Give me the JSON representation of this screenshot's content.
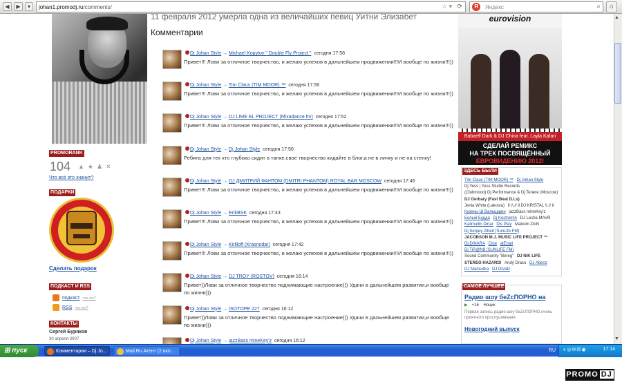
{
  "browser": {
    "url_domain": "johan1.promodj.ru",
    "url_path": "/comments/",
    "search_placeholder": "Яндекс",
    "search_logo": "Я"
  },
  "article_title": "11 февраля 2012 умерла одна из величайших певиц Уитни Элизабет",
  "comments_heading": "Комментарии",
  "sidebar": {
    "promorank_title": "PROMORANK",
    "rank_value": "104",
    "rank_link": "Что всё это значит?",
    "gifts_title": "ПОДАРКИ",
    "gift_link": "Сделать подарок",
    "podcast_title": "ПОДКАСТ И RSS",
    "podcast_label": "подкаст",
    "rss_label": "RSS",
    "small_label": "что это?",
    "contacts_title": "КОНТАКТЫ",
    "contact_name": "Сергей Буряков",
    "contact_date": "30 апреля 2007"
  },
  "comments": [
    {
      "author": "Dj Johan Style",
      "target": "Michael Kopytov \" Double Fly Project \"",
      "time": "сегодня 17:58",
      "text": "Привет!!! Лови за отличное творчество, и желаю успехов в дальнейшем продвижении!!!И вообще по жизни!!!))"
    },
    {
      "author": "Dj Johan Style",
      "target": "Tim Claus (TIM MOOR) ™",
      "time": "сегодня 17:56",
      "text": "Привет!!! Лови за отличное творчество, и желаю успехов в дальнейшем продвижении!!!И вообще по жизни!!!))"
    },
    {
      "author": "Dj Johan Style",
      "target": "DJ LIME EL PROJECT (Mixadance.fm)",
      "time": "сегодня 17:52",
      "text": "Привет!!! Лови за отличное творчество, и желаю успехов в дальнейшем продвижении!!!И вообще по жизни!!!))"
    },
    {
      "author": "Dj Johan Style",
      "target": "Dj Johan Style",
      "time": "сегодня 17:50",
      "text": "Ребята для тех кто глубоко сидит в танке,свое творчество кидайте в блог,а не в личку и не на стенку!"
    },
    {
      "author": "Dj Johan Style",
      "target": "DJ ДМИТРИЙ ФАНТОМ (DMITRI PHANTOM) ROYAL BAR MOSCOW",
      "time": "сегодня 17:46",
      "text": "Привет!!! Лови за отличное творчество, и желаю успехов в дальнейшем продвижении!!!И вообще по жизни!!!))"
    },
    {
      "author": "Dj Johan Style",
      "target": "ErikBSK",
      "time": "сегодня 17:43",
      "text": "Привет!!! Лови за отличное творчество, и желаю успехов в дальнейшем продвижении!!!И вообще по жизни!!!))"
    },
    {
      "author": "Dj Johan Style",
      "target": "Kirilloff (Krasnodar)",
      "time": "сегодня 17:42",
      "text": "Привет!!! Лови за отличное творчество, и желаю успехов в дальнейшем продвижении!!!И вообще по жизни!!!))"
    },
    {
      "author": "Dj Johan Style",
      "target": "DJ TROY (ROSTOV)",
      "time": "сегодня 16:14",
      "text": "Привет))Лови за отличное творчество поднимающие настроение))) Удачи в дальнейшем развитии,и вообще по жизни)))"
    },
    {
      "author": "Dj Johan Style",
      "target": "ISOTOPE 227",
      "time": "сегодня 16:12",
      "text": "Привет))Лови за отличное творчество поднимающие настроение))) Удачи в дальнейшем развитии,и вообще по жизни)))"
    },
    {
      "author": "Dj Johan Style",
      "target": "jazzBass mineKey'z",
      "time": "сегодня 16:12",
      "text": ""
    }
  ],
  "promo": {
    "logo": "eurovision",
    "caption": "Babaeff Dark & DJ China feat. Layla Kafari",
    "cta_line1": "СДЕЛАЙ РЕМИКС",
    "cta_line2": "НА ТРЕК ПОСВЯЩЁННЫЙ",
    "cta_line3": "ЕВРОВИДЕНИЮ 2012!"
  },
  "visitors": {
    "title": "ЗДЕСЬ БЫЛИ",
    "items": [
      {
        "name": "Tim Claus (TIM MOOR) ™",
        "style": "link"
      },
      {
        "name": "Dj Johan Style",
        "style": "link"
      },
      {
        "name": "Dj Yess | Yess Studio Records",
        "style": ""
      },
      {
        "name": "(Clubmood) Dj Performance & Dj Tenere (Moscow)",
        "style": ""
      },
      {
        "name": "DJ Gerbary (Fast Beat D.Ls)",
        "style": "bold"
      },
      {
        "name": "Jenia White (Lakosta)",
        "style": ""
      },
      {
        "name": "Il \\\\.// il DJ KRISTAL \\\\.// il",
        "style": ""
      },
      {
        "name": "Кузены Ш Вальцарин",
        "style": "link"
      },
      {
        "name": "jazzBass mineKey'z",
        "style": ""
      },
      {
        "name": "Белый Будда",
        "style": "link"
      },
      {
        "name": "Dj Kostromin",
        "style": "link"
      },
      {
        "name": "DJ Lesha MAVR",
        "style": ""
      },
      {
        "name": "Kalimullin Dinar",
        "style": "link"
      },
      {
        "name": "Dis Play",
        "style": "link"
      },
      {
        "name": "Maksim ZloN",
        "style": ""
      },
      {
        "name": "Dj Sergey Zibert [SunLife FM]",
        "style": "link"
      },
      {
        "name": "JACOBSON M.J. MUSIC LIFE PROJECT ™",
        "style": "bold"
      },
      {
        "name": "Dj-DiNARA",
        "style": "link"
      },
      {
        "name": "Oise",
        "style": "link"
      },
      {
        "name": "alEnati",
        "style": "link"
      },
      {
        "name": "Dj TiR@N$ (SUNLIFE FM)",
        "style": "link"
      },
      {
        "name": "Sound Community \"Bereg\"",
        "style": ""
      },
      {
        "name": "DJ NIK LIFE",
        "style": "bold"
      },
      {
        "name": "STEREO HAZARD!",
        "style": "bold"
      },
      {
        "name": "Andy Draco",
        "style": ""
      },
      {
        "name": "DJ Abenz",
        "style": "link"
      },
      {
        "name": "DJ Mamu4ka",
        "style": "link"
      },
      {
        "name": "DJ DiVaD",
        "style": "link"
      }
    ]
  },
  "best": {
    "title_label": "САМОЕ ЛУЧШЕЕ",
    "podcast_title": "Радио шоу беZсПОРНО на",
    "count": "+16",
    "category": "Ноцик",
    "description": "Первая запись радио шоу беZсПОРНО,очень приятного прослушивания.",
    "next_title": "Новогодний выпуск"
  },
  "taskbar": {
    "start_label": "пуск",
    "task1": "Комментарии – Dj Jo...",
    "task2": "Mail.Ru Агент (2 вкл...",
    "lang": "RU",
    "clock": "17:14"
  },
  "watermark": {
    "left": "PROMO",
    "right": "DJ"
  },
  "colors": {
    "section_red": "#9b1e1e",
    "link_blue": "#1a4f9e",
    "taskbar_blue": "#245edb"
  }
}
